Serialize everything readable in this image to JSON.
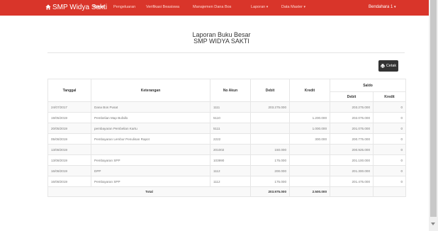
{
  "navbar": {
    "brand": "SMP Widya Sakti",
    "items": [
      {
        "label": "Home",
        "active": true,
        "dropdown": false
      },
      {
        "label": "Pengeluaran",
        "active": false,
        "dropdown": false
      },
      {
        "label": "Verifikasi Beasiswa",
        "active": false,
        "dropdown": false
      },
      {
        "label": "Manajemen Dana Bos",
        "active": false,
        "dropdown": false
      },
      {
        "label": "Laporan",
        "active": false,
        "dropdown": true
      },
      {
        "label": "Data Master",
        "active": false,
        "dropdown": true
      }
    ],
    "user": "Bendahara 1",
    "color": "#d9352a"
  },
  "report": {
    "title": "Laporan Buku Besar",
    "subtitle": "SMP WIDYA SAKTI",
    "print_label": "Cetak"
  },
  "table": {
    "headers": {
      "tanggal": "Tanggal",
      "keterangan": "Keterangan",
      "no_akun": "No Akun",
      "debit": "Debit",
      "kredit": "Kredit",
      "saldo": "Saldo",
      "saldo_debit": "Debit",
      "saldo_kredit": "Kredit"
    },
    "rows": [
      {
        "tanggal": "24/07/2017",
        "keterangan": "Dana Bos Pusat",
        "no_akun": "1111",
        "debit": "203.275.000",
        "kredit": "",
        "saldo_debit": "203.275.000",
        "saldo_kredit": "0"
      },
      {
        "tanggal": "19/05/2019",
        "keterangan": "Pembelian Map Bufallo",
        "no_akun": "5110",
        "debit": "",
        "kredit": "1.200.000",
        "saldo_debit": "202.075.000",
        "saldo_kredit": "0"
      },
      {
        "tanggal": "20/05/2019",
        "keterangan": "pembayaran Pembelian Kartu",
        "no_akun": "5111",
        "debit": "",
        "kredit": "1.000.000",
        "saldo_debit": "201.075.000",
        "saldo_kredit": "0"
      },
      {
        "tanggal": "05/08/2019",
        "keterangan": "Pembayaran Lembur Penulisan Rapot",
        "no_akun": "2222",
        "debit": "",
        "kredit": "300.000",
        "saldo_debit": "200.775.000",
        "saldo_kredit": "0"
      },
      {
        "tanggal": "13/08/2019",
        "keterangan": "",
        "no_akun": "201002",
        "debit": "150.000",
        "kredit": "",
        "saldo_debit": "200.925.000",
        "saldo_kredit": "0"
      },
      {
        "tanggal": "13/08/2019",
        "keterangan": "Pembayaran SPP",
        "no_akun": "103990",
        "debit": "175.000",
        "kredit": "",
        "saldo_debit": "201.100.000",
        "saldo_kredit": "0"
      },
      {
        "tanggal": "16/08/2019",
        "keterangan": "DPP",
        "no_akun": "1112",
        "debit": "200.000",
        "kredit": "",
        "saldo_debit": "201.300.000",
        "saldo_kredit": "0"
      },
      {
        "tanggal": "16/08/2019",
        "keterangan": "Pembayaran SPP",
        "no_akun": "1112",
        "debit": "175.000",
        "kredit": "",
        "saldo_debit": "201.475.000",
        "saldo_kredit": "0"
      }
    ],
    "total": {
      "label": "Total",
      "debit": "203.975.000",
      "kredit": "2.500.000"
    }
  }
}
